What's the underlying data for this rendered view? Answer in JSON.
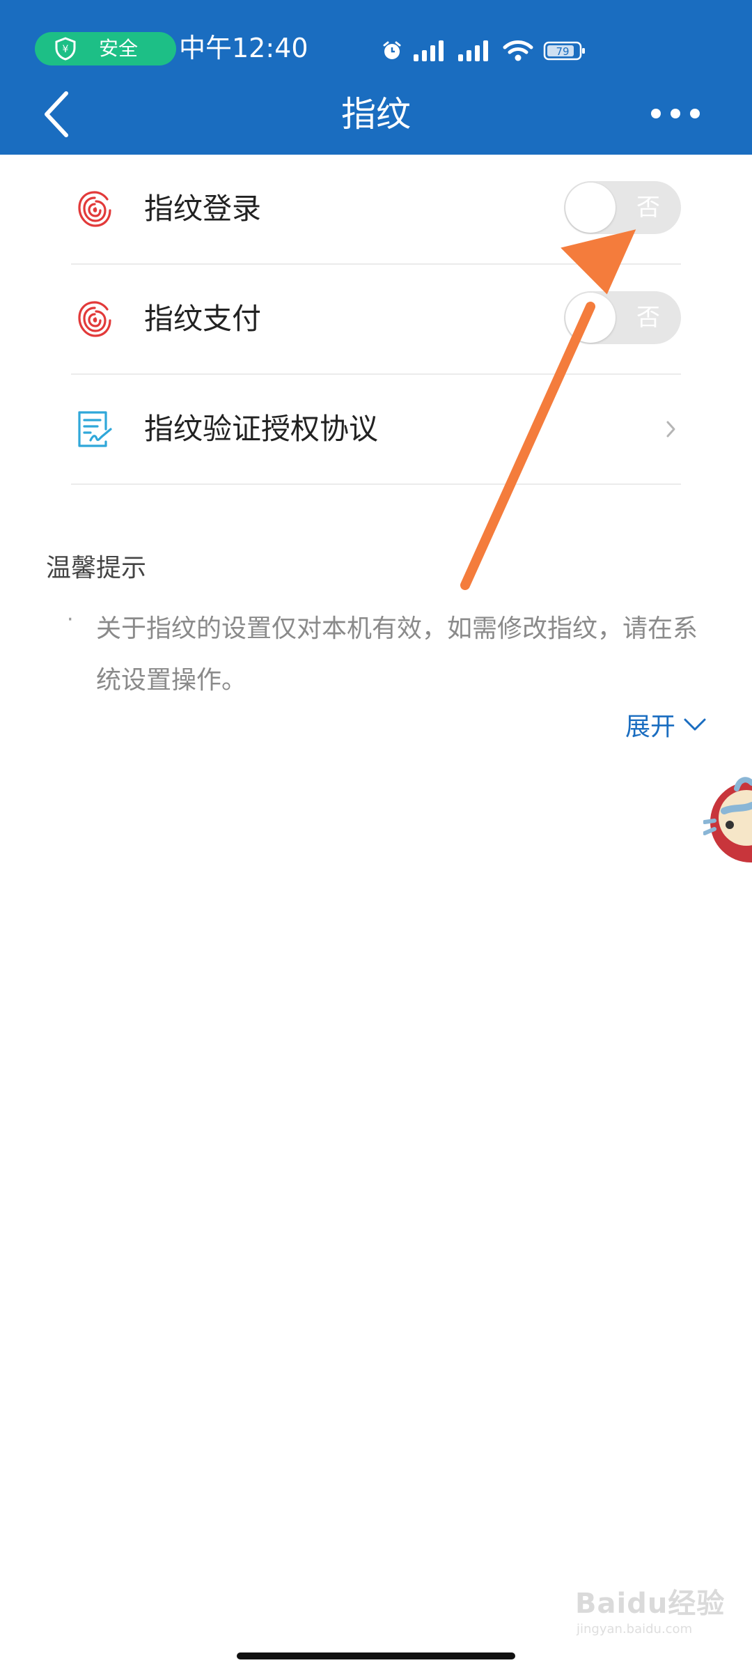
{
  "status_bar": {
    "security_label": "安全",
    "time": "中午12:40",
    "battery": "79"
  },
  "navbar": {
    "title": "指纹"
  },
  "settings": [
    {
      "label": "指纹登录",
      "toggle_text": "否",
      "enabled": false
    },
    {
      "label": "指纹支付",
      "toggle_text": "否",
      "enabled": false
    },
    {
      "label": "指纹验证授权协议"
    }
  ],
  "tips": {
    "title": "温馨提示",
    "bullet": "·",
    "text": "关于指纹的设置仅对本机有效，如需修改指纹，请在系统设置操作。",
    "expand_label": "展开"
  },
  "watermark": {
    "main": "Baidu经验",
    "sub": "jingyan.baidu.com"
  },
  "colors": {
    "header": "#1a6dc0",
    "security": "#1dbf86",
    "fingerprint": "#e23a3a",
    "agreement_icon": "#2fa7d9",
    "arrow": "#f47c3c",
    "link": "#1a6dc0"
  }
}
